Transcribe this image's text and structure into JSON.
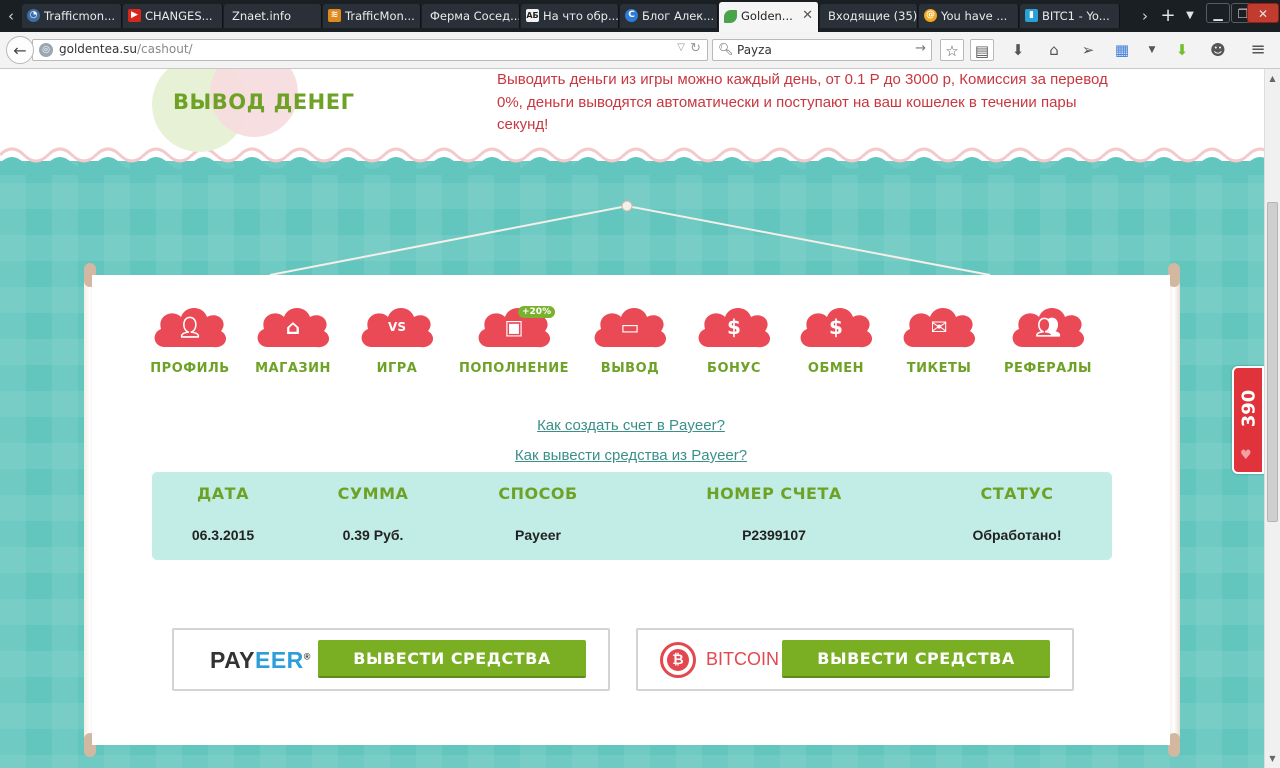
{
  "browser": {
    "tabs": [
      {
        "label": "Trafficmon...",
        "icon": "circle-icon",
        "color": "#3a6ea5"
      },
      {
        "label": "CHANGES...",
        "icon": "youtube-icon",
        "color": "#d9251c"
      },
      {
        "label": "Znaet.info",
        "icon": "",
        "color": ""
      },
      {
        "label": "TrafficMon...",
        "icon": "trafficmon-icon",
        "color": "#e08a1e"
      },
      {
        "label": "Ферма Сосед...",
        "icon": "",
        "color": ""
      },
      {
        "label": "На что обр...",
        "icon": "ab-icon",
        "color": "#444444"
      },
      {
        "label": "Блог Алек...",
        "icon": "blog-icon",
        "color": "#2f7bd6"
      },
      {
        "label": "Golden...",
        "icon": "leaf-icon",
        "color": "#4aa34a",
        "active": true
      },
      {
        "label": "Входящие (35) ...",
        "icon": "",
        "color": ""
      },
      {
        "label": "You have ...",
        "icon": "at-icon",
        "color": "#f2a81e"
      },
      {
        "label": "BITC1 - Yo...",
        "icon": "chart-icon",
        "color": "#2aa0d8"
      }
    ],
    "url": {
      "domain": "goldentea.su",
      "path": "/cashout/"
    },
    "search": "Payza"
  },
  "header": {
    "title": "ВЫВОД ДЕНЕГ",
    "info": "Выводить деньги из игры можно каждый день, от 0.1 Р до 3000 р, Комиссия за перевод 0%, деньги выводятся автоматически и поступают на ваш кошелек в течении пары секунд!"
  },
  "menu": {
    "items": [
      {
        "label": "ПРОФИЛЬ",
        "icon": "profile-icon"
      },
      {
        "label": "МАГАЗИН",
        "icon": "shop-icon"
      },
      {
        "label": "ИГРА",
        "icon": "game-vs-icon",
        "glyph": "VS"
      },
      {
        "label": "ПОПОЛНЕНИЕ",
        "icon": "topup-icon",
        "badge": "+20%"
      },
      {
        "label": "ВЫВОД",
        "icon": "wallet-icon"
      },
      {
        "label": "БОНУС",
        "icon": "dollar-coin-icon",
        "glyph": "$"
      },
      {
        "label": "ОБМЕН",
        "icon": "exchange-icon",
        "glyph": "$"
      },
      {
        "label": "ТИКЕТЫ",
        "icon": "envelope-icon"
      },
      {
        "label": "РЕФЕРАЛЫ",
        "icon": "users-icon"
      }
    ]
  },
  "help_links": [
    "Как создать счет в Payeer?",
    "Как вывести средства из Payeer?"
  ],
  "table": {
    "headers": [
      "ДАТА",
      "СУММА",
      "СПОСОБ",
      "НОМЕР СЧЕТА",
      "СТАТУС"
    ],
    "rows": [
      [
        "06.3.2015",
        "0.39 Руб.",
        "Payeer",
        "P2399107",
        "Обработано!"
      ]
    ]
  },
  "payments": {
    "payeer": {
      "logo_a": "PAY",
      "logo_b": "EER",
      "logo_mark": "®",
      "button": "ВЫВЕСТИ СРЕДСТВА"
    },
    "bitcoin": {
      "logo_symbol": "₿",
      "logo_text": "BITCOIN",
      "button": "ВЫВЕСТИ СРЕДСТВА"
    }
  },
  "side_widget": {
    "value": "390"
  },
  "colors": {
    "accent_green": "#6ea227",
    "accent_red": "#e4484f",
    "teal": "#63c6be",
    "table_bg": "#c2ece6"
  }
}
